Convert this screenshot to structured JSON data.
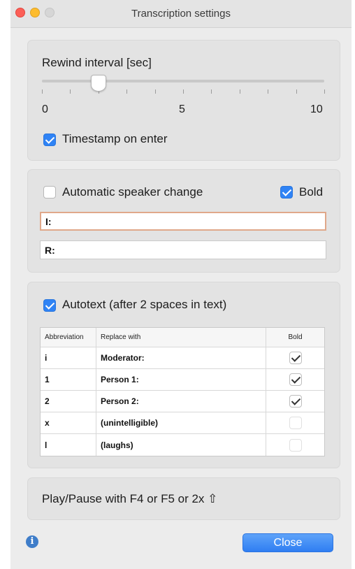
{
  "window": {
    "title": "Transcription settings"
  },
  "rewind": {
    "label": "Rewind interval [sec]",
    "min_label": "0",
    "mid_label": "5",
    "max_label": "10",
    "value_sec": 2
  },
  "timestamp": {
    "label": "Timestamp on enter",
    "checked": true
  },
  "speaker": {
    "auto_label": "Automatic speaker change",
    "auto_checked": false,
    "bold_label": "Bold",
    "bold_checked": true,
    "field1_value": "I:",
    "field2_value": "R:"
  },
  "autotext": {
    "label": "Autotext (after 2 spaces in text)",
    "checked": true,
    "columns": [
      "Abbreviation",
      "Replace with",
      "Bold"
    ],
    "rows": [
      {
        "abbr": "i",
        "replace": "Moderator:",
        "bold": true
      },
      {
        "abbr": "1",
        "replace": "Person 1:",
        "bold": true
      },
      {
        "abbr": "2",
        "replace": "Person 2:",
        "bold": true
      },
      {
        "abbr": "x",
        "replace": "(unintelligible)",
        "bold": false
      },
      {
        "abbr": "l",
        "replace": "(laughs)",
        "bold": false
      }
    ]
  },
  "playpause": {
    "label": "Play/Pause with F4 or F5 or 2x ⇧"
  },
  "footer": {
    "close_label": "Close",
    "info_glyph": "i",
    "info_icon": "info-icon"
  },
  "colors": {
    "accent": "#2f83f5",
    "focus_ring": "#e0a88a"
  }
}
